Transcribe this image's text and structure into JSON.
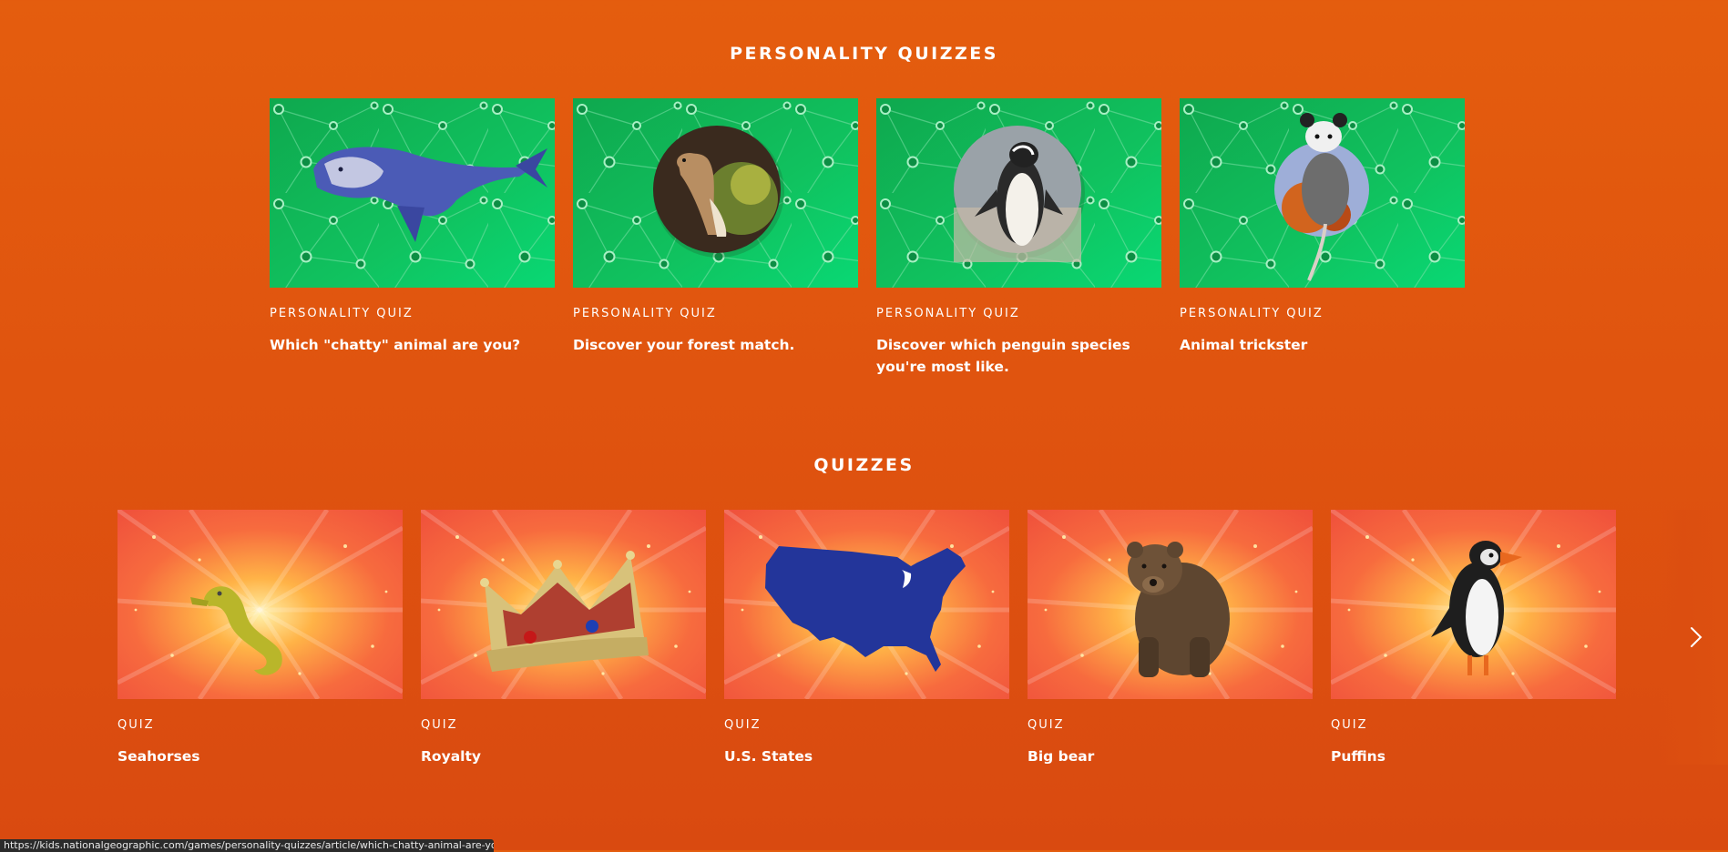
{
  "personality": {
    "heading": "PERSONALITY QUIZZES",
    "cards": [
      {
        "kicker": "PERSONALITY QUIZ",
        "title": "Which \"chatty\" animal are you?",
        "image": "dolphin"
      },
      {
        "kicker": "PERSONALITY QUIZ",
        "title": "Discover your forest match.",
        "image": "weasel"
      },
      {
        "kicker": "PERSONALITY QUIZ",
        "title": "Discover which penguin species you're most like.",
        "image": "penguin"
      },
      {
        "kicker": "PERSONALITY QUIZ",
        "title": "Animal trickster",
        "image": "opossum"
      }
    ]
  },
  "quizzes": {
    "heading": "QUIZZES",
    "cards": [
      {
        "kicker": "QUIZ",
        "title": "Seahorses",
        "image": "seahorse"
      },
      {
        "kicker": "QUIZ",
        "title": "Royalty",
        "image": "crown"
      },
      {
        "kicker": "QUIZ",
        "title": "U.S. States",
        "image": "usa-map"
      },
      {
        "kicker": "QUIZ",
        "title": "Big bear",
        "image": "bear"
      },
      {
        "kicker": "QUIZ",
        "title": "Puffins",
        "image": "puffin"
      }
    ]
  },
  "carousel": {
    "next_icon": "chevron-right-icon"
  },
  "status_bar": {
    "url": "https://kids.nationalgeographic.com/games/personality-quizzes/article/which-chatty-animal-are-you"
  },
  "colors": {
    "page_bg": "#e0540f",
    "personality_thumb_bg": "#13b85a",
    "quiz_thumb_bg": "#f26a3a"
  }
}
